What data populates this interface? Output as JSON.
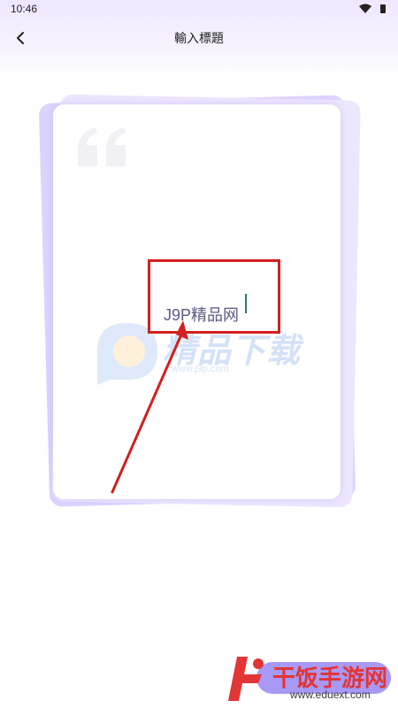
{
  "status_bar": {
    "time": "10:46"
  },
  "header": {
    "title": "輸入標題",
    "back_icon": "chevron-left-icon"
  },
  "editor": {
    "title_value": "J9P精品网"
  },
  "watermark": {
    "brand": "精品下载",
    "url": "www.j9p.com"
  },
  "bottom_watermark": {
    "title": "干饭手游网",
    "url": "www.eduext.com"
  },
  "colors": {
    "accent": "#7a63f0",
    "highlight": "#d31f1f",
    "header_gradient": "#efe7ff"
  }
}
